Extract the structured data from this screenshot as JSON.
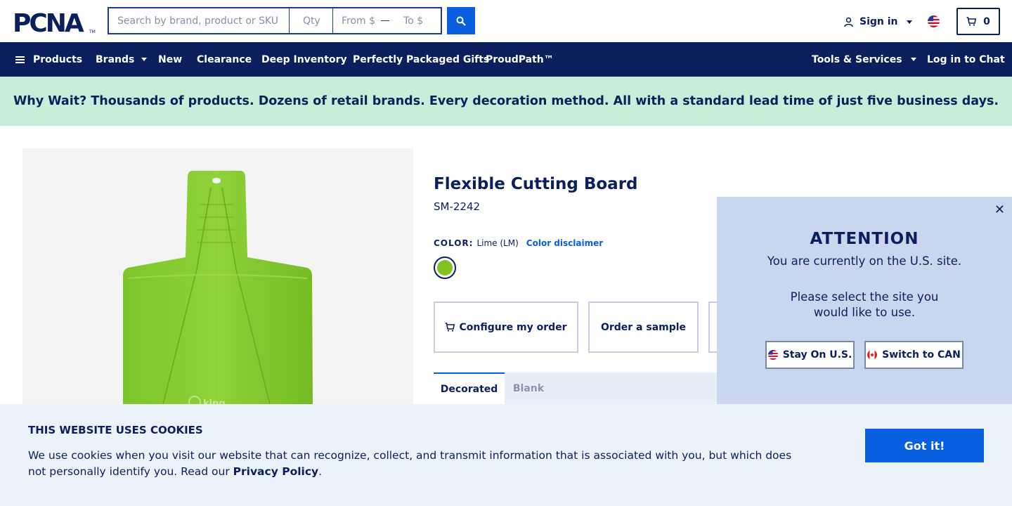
{
  "header": {
    "logo_text": "PCNA",
    "search": {
      "placeholder": "Search by brand, product or SKU",
      "value": ""
    },
    "qty": {
      "placeholder": "Qty"
    },
    "price_from": {
      "placeholder": "From $"
    },
    "price_to": {
      "placeholder": "To $"
    },
    "search_button_icon": "search-icon",
    "sign_in_label": "Sign in",
    "flag": "us-flag",
    "cart_count": "0"
  },
  "nav": {
    "items": [
      {
        "label": "Products"
      },
      {
        "label": "Brands"
      },
      {
        "label": "New"
      },
      {
        "label": "Clearance"
      },
      {
        "label": "Deep Inventory"
      },
      {
        "label": "Perfectly Packaged Gifts"
      },
      {
        "label": "ProudPath™"
      },
      {
        "label": "Tools & Services"
      },
      {
        "label": "Log in to Chat"
      }
    ]
  },
  "promo": {
    "text": "Why Wait? Thousands of products. Dozens of retail brands. Every decoration method. All with a standard lead time of just five business days."
  },
  "product": {
    "title": "Flexible Cutting Board",
    "sku": "SM-2242",
    "color_label": "COLOR:",
    "color_value": "Lime (LM)",
    "color_disclaimer": "Color disclaimer",
    "swatch_color": "#82c024",
    "image_brand_text": "king",
    "actions": [
      {
        "label": "Configure my order"
      },
      {
        "label": "Order a sample"
      }
    ],
    "tabs": [
      {
        "label": "Decorated",
        "active": true
      },
      {
        "label": "Blank",
        "active": false
      }
    ]
  },
  "attention": {
    "title": "ATTENTION",
    "line1": "You are currently on the U.S. site.",
    "line2": "Please select the site you would like to use.",
    "stay_label": "Stay On U.S.",
    "switch_label": "Switch to CAN"
  },
  "cookie": {
    "title": "THIS WEBSITE USES COOKIES",
    "text": "We use cookies when you visit our website that can recognize, collect, and transmit information that is associated with you, but which does not personally identify you. Read our ",
    "link": "Privacy Policy",
    "period": ".",
    "button": "Got it!"
  },
  "colors": {
    "navy": "#0a1f5c",
    "blue": "#0a5ee0",
    "promo_bg": "#c6efd9",
    "modal_bg": "#c9d6ee",
    "cookie_bg": "#ecf2fa"
  }
}
